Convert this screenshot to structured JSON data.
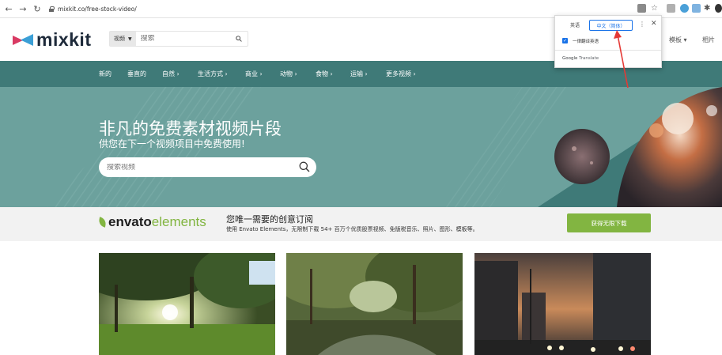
{
  "browser": {
    "url": "mixkit.co/free-stock-video/"
  },
  "site": {
    "logo_text": "mixkit",
    "search": {
      "category": "视频",
      "placeholder": "搜索"
    },
    "header_links": [
      "模板",
      "相片"
    ]
  },
  "categories": [
    {
      "label": "新的"
    },
    {
      "label": "垂直的"
    },
    {
      "label": "自然 ›"
    },
    {
      "label": "生活方式 ›"
    },
    {
      "label": "商业 ›"
    },
    {
      "label": "动物 ›"
    },
    {
      "label": "食物 ›"
    },
    {
      "label": "运输 ›"
    },
    {
      "label": "更多视频 ›"
    }
  ],
  "hero": {
    "title": "非凡的免费素材视频片段",
    "subtitle": "供您在下一个视频项目中免费使用!",
    "search_placeholder": "搜索视频"
  },
  "envato": {
    "logo_part1": "envato",
    "logo_part2": "elements",
    "heading": "您唯一需要的创意订阅",
    "body": "使用 Envato Elements，无限制下载 54+ 百万个优质股票视频、免版税音乐、照片、图形、模板等。",
    "cta": "获得无限下载"
  },
  "translate_popup": {
    "tab_source": "英语",
    "tab_target": "中文（简体）",
    "checkbox_label": "一律翻译英语",
    "checkbox_checked": true,
    "brand_google": "Google",
    "brand_translate": "Translate"
  },
  "colors": {
    "teal_bar": "#3f7a78",
    "hero_bg": "#6ca19d",
    "envato_green": "#82b541",
    "annotation_red": "#e53935",
    "google_blue": "#1a73e8"
  }
}
